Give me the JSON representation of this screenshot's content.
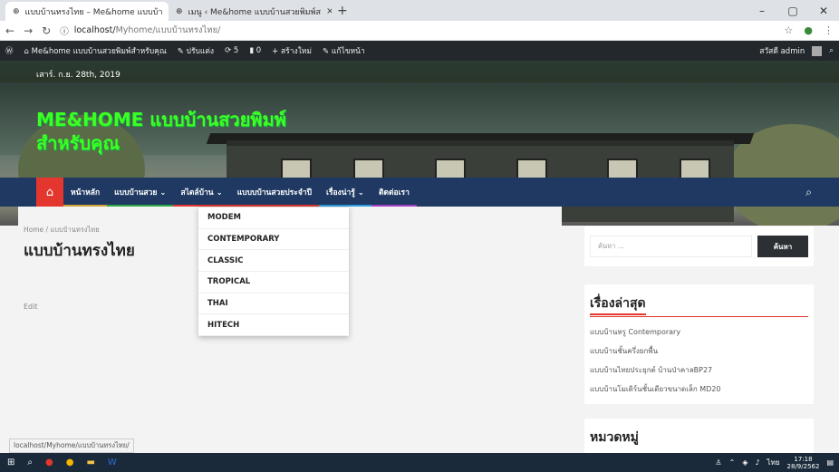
{
  "browser": {
    "tabs": [
      {
        "title": "แบบบ้านทรงไทย – Me&home แบบบ้า",
        "close": "×"
      },
      {
        "title": "เมนู ‹ Me&home แบบบ้านสวยพิมพ์ส",
        "close": "×"
      }
    ],
    "new_tab": "+",
    "url_host": "localhost/",
    "url_path": "Myhome/แบบบ้านทรงไทย/",
    "controls": {
      "minimize": "–",
      "maximize": "▢",
      "close": "✕"
    }
  },
  "adminbar": {
    "site": "Me&home แบบบ้านสวยพิมพ์สำหรับคุณ",
    "customize": "ปรับแต่ง",
    "updates": "5",
    "comments": "0",
    "new": "สร้างใหม่",
    "edit_page": "แก้ไขหน้า",
    "greeting": "สวัสดี admin"
  },
  "header": {
    "date": "เสาร์. ก.ย. 28th, 2019",
    "site_title": "ME&HOME แบบบ้านสวยพิมพ์สำหรับคุณ"
  },
  "nav": {
    "items": [
      {
        "label": "หน้าหลัก",
        "color": "#d1a13a"
      },
      {
        "label": "แบบบ้านสวย ⌄",
        "color": "#2ea94a"
      },
      {
        "label": "สไตล์บ้าน ⌄",
        "color": "#e2362e"
      },
      {
        "label": "แบบบบ้านสวยประจำปี",
        "color": "#e2362e"
      },
      {
        "label": "เรื่องน่ารู้ ⌄",
        "color": "#2b9de0"
      },
      {
        "label": "ติดต่อเรา",
        "color": "#a23ec0"
      }
    ]
  },
  "dropdown": [
    "MODEM",
    "CONTEMPORARY",
    "CLASSIC",
    "TROPICAL",
    "THAI",
    "HITECH"
  ],
  "main": {
    "breadcrumb": "Home / แบบบ้านทรงไทย",
    "title": "แบบบ้านทรงไทย",
    "edit": "Edit"
  },
  "sidebar": {
    "search_placeholder": "ค้นหา ...",
    "search_button": "ค้นหา",
    "recent_title": "เรื่องล่าสุด",
    "recent_posts": [
      "แบบบ้านหรู Contemporary",
      "แบบบ้านชั้นครึ่งยกพื้น",
      "แบบบ้านไทยประยุกต์ บ้านป่าคาลBP27",
      "แบบบ้านโมเดิร์นชั้นเดียวขนาดเล็ก MD20"
    ],
    "categories_title": "หมวดหมู่"
  },
  "statusbar": "localhost/Myhome/แบบบ้านทรงไทย/",
  "taskbar": {
    "time": "17:18",
    "date": "28/9/2562",
    "lang": "ไทย"
  }
}
